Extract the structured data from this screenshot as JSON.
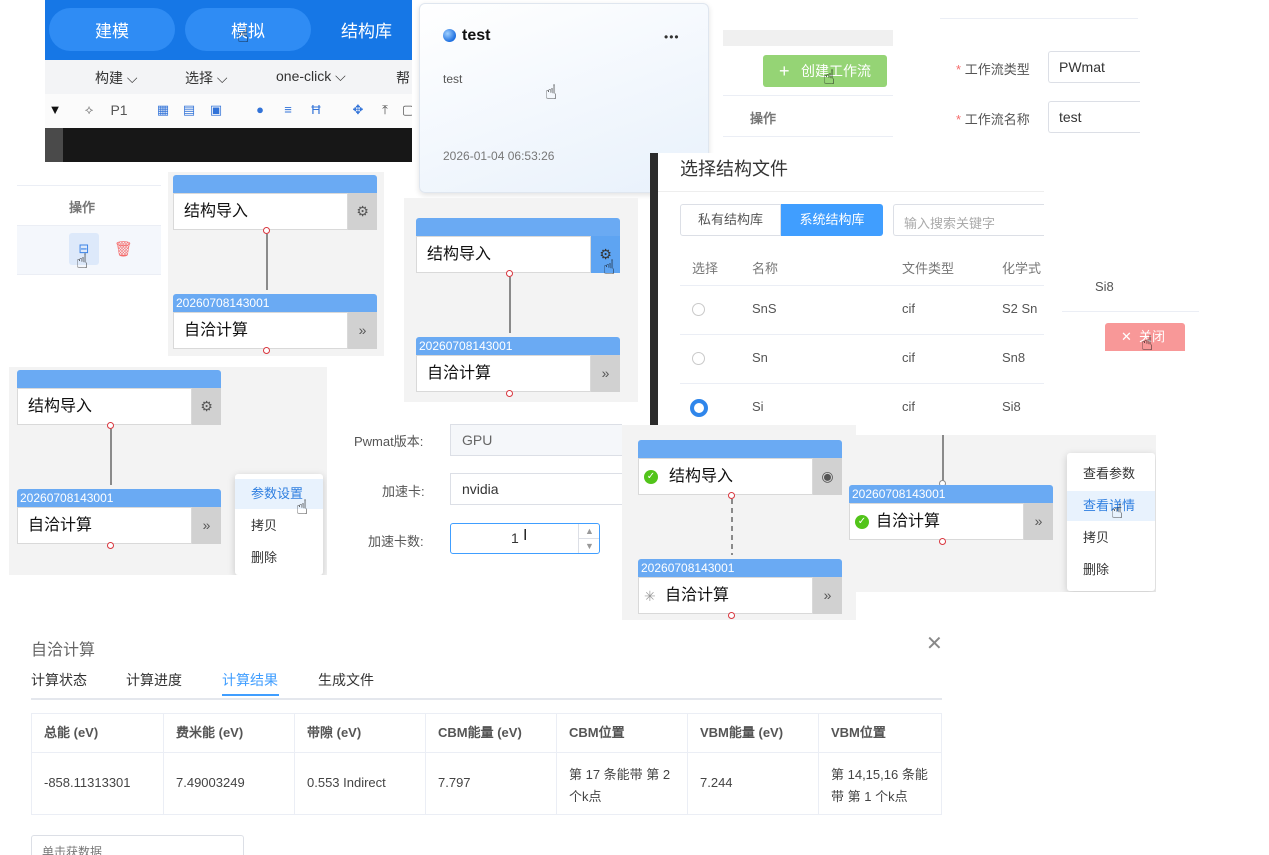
{
  "toolbar": {
    "nav": [
      "建模",
      "模拟",
      "结构库"
    ],
    "menu": [
      "构建",
      "选择",
      "one-click",
      "帮"
    ],
    "p1_label": "P1"
  },
  "workflow_card": {
    "title": "test",
    "more": "•••",
    "desc": "test",
    "time": "2026-01-04 06:53:26"
  },
  "create_panel": {
    "create_button": "创建工作流",
    "ops_header": "操作"
  },
  "form": {
    "type_label": "工作流类型",
    "type_value": "PWmat",
    "name_label": "工作流名称",
    "name_value": "test",
    "required_mark": "*"
  },
  "ops_panel": {
    "header": "操作"
  },
  "nodes": {
    "import_label": "结构导入",
    "calc_label": "自洽计算",
    "calc_id": "20260708143001"
  },
  "dialog": {
    "title": "选择结构文件",
    "tab_private": "私有结构库",
    "tab_system": "系统结构库",
    "search_placeholder": "输入搜索关键字",
    "headers": [
      "选择",
      "名称",
      "文件类型",
      "化学式"
    ],
    "rows": [
      {
        "name": "SnS",
        "type": "cif",
        "formula": "S2 Sn"
      },
      {
        "name": "Sn",
        "type": "cif",
        "formula": "Sn8"
      },
      {
        "name": "Si",
        "type": "cif",
        "formula": "Si8"
      }
    ]
  },
  "close_panel": {
    "formula": "Si8",
    "close_label": "关闭"
  },
  "pwmat_form": {
    "version_label": "Pwmat版本:",
    "version_value": "GPU",
    "card_label": "加速卡:",
    "card_value": "nvidia",
    "count_label": "加速卡数:",
    "count_value": "1"
  },
  "ctx_menu_1": [
    "参数设置",
    "拷贝",
    "删除"
  ],
  "ctx_menu_2": [
    "查看参数",
    "查看详情",
    "拷贝",
    "删除"
  ],
  "results": {
    "title": "自洽计算",
    "tabs": [
      "计算状态",
      "计算进度",
      "计算结果",
      "生成文件"
    ],
    "active_tab": 2,
    "headers": [
      "总能 (eV)",
      "费米能 (eV)",
      "带隙 (eV)",
      "CBM能量 (eV)",
      "CBM位置",
      "VBM能量 (eV)",
      "VBM位置"
    ],
    "row": [
      "-858.11313301",
      "7.49003249",
      "0.553 Indirect",
      "7.797",
      "第 17 条能带 第 2 个k点",
      "7.244",
      "第 14,15,16 条能带 第 1 个k点"
    ],
    "select_partial": "单击获数据"
  },
  "colors": {
    "primary": "#1677e6",
    "node_head": "#6aaaf3",
    "green": "#52c41a",
    "danger": "#f56c6c"
  }
}
